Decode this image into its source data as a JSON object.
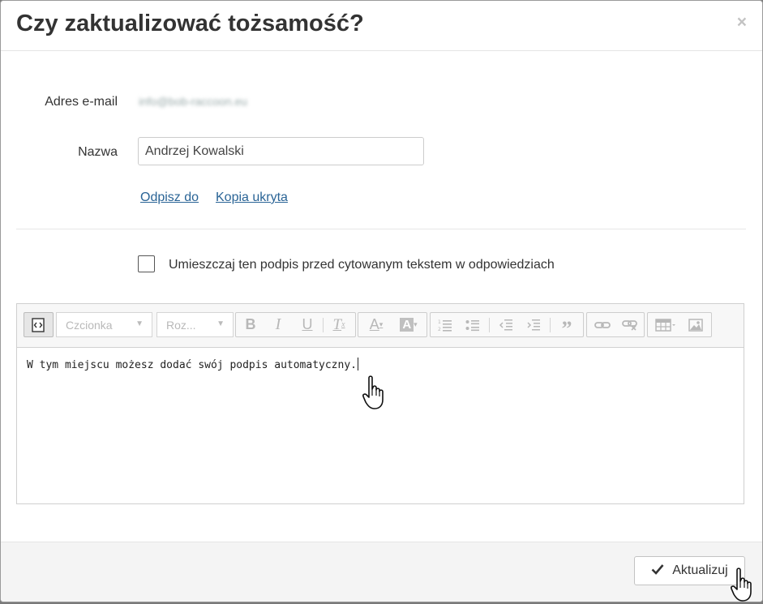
{
  "dialog": {
    "title": "Czy zaktualizować tożsamość?",
    "close": "×"
  },
  "form": {
    "email_label": "Adres e-mail",
    "email_value": "info@bob-raccoon.eu",
    "name_label": "Nazwa",
    "name_value": "Andrzej Kowalski",
    "links": {
      "reply_to": "Odpisz do",
      "bcc": "Kopia ukryta"
    },
    "checkbox_label": "Umieszczaj ten podpis przed cytowanym tekstem w odpowiedziach",
    "checkbox_checked": false
  },
  "editor": {
    "font_placeholder": "Czcionka",
    "size_placeholder": "Roz...",
    "content": "W tym miejscu możesz dodać swój podpis automatyczny."
  },
  "footer": {
    "update_label": "Aktualizuj",
    "update_icon": "check-icon"
  },
  "colors": {
    "link": "#2a6496",
    "disabled_icon": "#b8b8b8"
  }
}
